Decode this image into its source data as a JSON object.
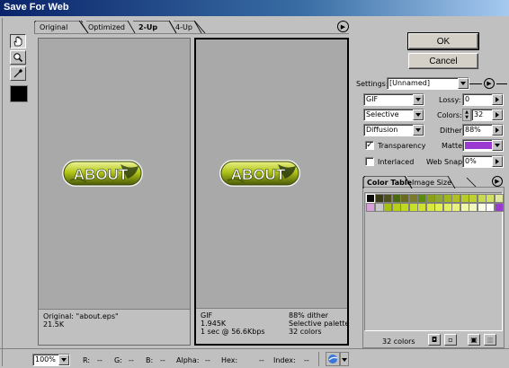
{
  "window": {
    "title": "Save For Web"
  },
  "tabs": [
    {
      "label": "Original",
      "active": false
    },
    {
      "label": "Optimized",
      "active": false
    },
    {
      "label": "2-Up",
      "active": true
    },
    {
      "label": "4-Up",
      "active": false
    }
  ],
  "tools": [
    "hand-icon",
    "zoom-icon",
    "eyedropper-icon"
  ],
  "preview": {
    "button_text": "ABOUT",
    "original": {
      "name": "Original: \"about.eps\"",
      "size": "21.5K"
    },
    "optimized": {
      "format": "GIF",
      "size": "1.945K",
      "time": "1 sec @ 56.6Kbps",
      "dither": "88% dither",
      "palette": "Selective palette",
      "colors": "32 colors"
    }
  },
  "buttons": {
    "ok": "OK",
    "cancel": "Cancel"
  },
  "settings": {
    "label": "Settings:",
    "preset": "[Unnamed]",
    "format": "GIF",
    "palette": "Selective",
    "dither_algo": "Diffusion",
    "lossy_label": "Lossy:",
    "lossy": "0",
    "colors_label": "Colors:",
    "colors": "32",
    "dither_label": "Dither:",
    "dither": "88%",
    "transparency_label": "Transparency",
    "transparency": true,
    "matte_label": "Matte:",
    "matte_color": "#9a3ad0",
    "interlaced_label": "Interlaced",
    "interlaced": false,
    "websnap_label": "Web Snap:",
    "websnap": "0%"
  },
  "color_table": {
    "tabs": [
      "Color Table",
      "Image Size"
    ],
    "count_label": "32 colors",
    "swatches": [
      "#0a0a0a",
      "#3a3a14",
      "#50501c",
      "#4a6a10",
      "#6a6a20",
      "#7a7a28",
      "#5a8a10",
      "#8aa018",
      "#90a830",
      "#a0b818",
      "#b0c020",
      "#b8cc28",
      "#c0d030",
      "#c8d850",
      "#d0e060",
      "#e0e8a0",
      "#d8a0d8",
      "#c8c8c8",
      "#a8c010",
      "#b8d018",
      "#c0d820",
      "#c8e028",
      "#d0e030",
      "#d8e840",
      "#e0f050",
      "#e0f060",
      "#e8f080",
      "#f0f8a8",
      "#f0f8c0",
      "#f8fce0",
      "#ffffff",
      "#9a3ad0"
    ]
  },
  "status": {
    "zoom": "100%",
    "r": "R:",
    "r_val": "--",
    "g": "G:",
    "g_val": "--",
    "b": "B:",
    "b_val": "--",
    "alpha": "Alpha:",
    "alpha_val": "--",
    "hex": "Hex:",
    "hex_val": "--",
    "index": "Index:",
    "index_val": "--"
  }
}
